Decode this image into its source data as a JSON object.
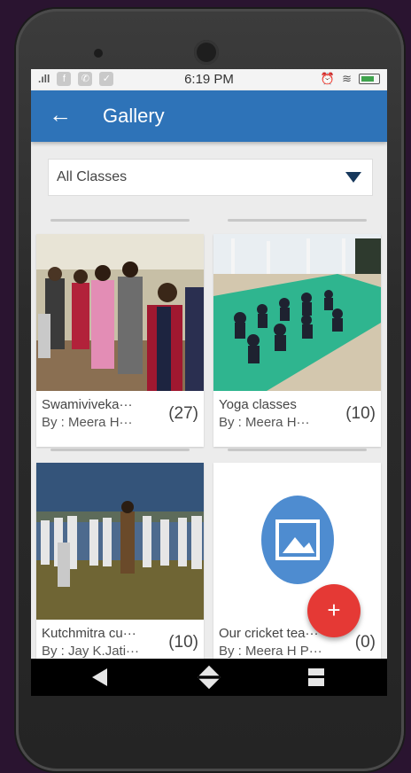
{
  "status_bar": {
    "signal": "Aıl",
    "time": "6:19 PM"
  },
  "app_bar": {
    "back_icon": "arrow-left-icon",
    "title": "Gallery"
  },
  "filter": {
    "selected": "All Classes"
  },
  "albums": [
    {
      "name": "Swamiviveka···",
      "by": "By : Meera H···",
      "count": "(27)"
    },
    {
      "name": "Yoga classes",
      "by": "By : Meera H···",
      "count": "(10)"
    },
    {
      "name": "Kutchmitra cu···",
      "by": "By : Jay K.Jati···",
      "count": "(10)"
    },
    {
      "name": "Our cricket tea···",
      "by": "By : Meera H P···",
      "count": "(0)"
    }
  ],
  "fab": {
    "label": "+"
  },
  "colors": {
    "app_bar": "#2e73b8",
    "fab": "#e53935",
    "placeholder": "#4e8cd0"
  }
}
